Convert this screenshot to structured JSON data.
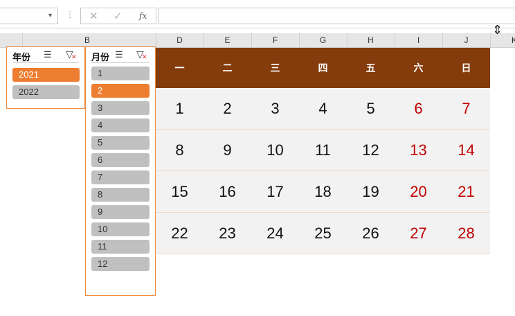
{
  "formula_bar": {
    "cancel_icon": "✕",
    "enter_icon": "✓",
    "fx_label": "fx",
    "formula": ""
  },
  "columns": [
    "B",
    "D",
    "E",
    "F",
    "G",
    "H",
    "I",
    "J",
    "K"
  ],
  "year_slicer": {
    "title": "年份",
    "items": [
      {
        "label": "2021",
        "selected": true
      },
      {
        "label": "2022",
        "selected": false
      }
    ]
  },
  "month_slicer": {
    "title": "月份",
    "items": [
      {
        "label": "1",
        "selected": false
      },
      {
        "label": "2",
        "selected": true
      },
      {
        "label": "3",
        "selected": false
      },
      {
        "label": "4",
        "selected": false
      },
      {
        "label": "5",
        "selected": false
      },
      {
        "label": "6",
        "selected": false
      },
      {
        "label": "7",
        "selected": false
      },
      {
        "label": "8",
        "selected": false
      },
      {
        "label": "9",
        "selected": false
      },
      {
        "label": "10",
        "selected": false
      },
      {
        "label": "11",
        "selected": false
      },
      {
        "label": "12",
        "selected": false
      }
    ]
  },
  "calendar": {
    "weekdays": [
      "一",
      "二",
      "三",
      "四",
      "五",
      "六",
      "日"
    ],
    "weeks": [
      [
        "1",
        "2",
        "3",
        "4",
        "5",
        "6",
        "7"
      ],
      [
        "8",
        "9",
        "10",
        "11",
        "12",
        "13",
        "14"
      ],
      [
        "15",
        "16",
        "17",
        "18",
        "19",
        "20",
        "21"
      ],
      [
        "22",
        "23",
        "24",
        "25",
        "26",
        "27",
        "28"
      ]
    ],
    "colors": {
      "header_bg": "#843c0c",
      "weekend": "#c00000",
      "body_bg": "#f2f2f2"
    }
  },
  "colors": {
    "slicer_selected": "#ed7d31",
    "slicer_item": "#c0c0c0",
    "slicer_border": "#ed8b3e"
  }
}
